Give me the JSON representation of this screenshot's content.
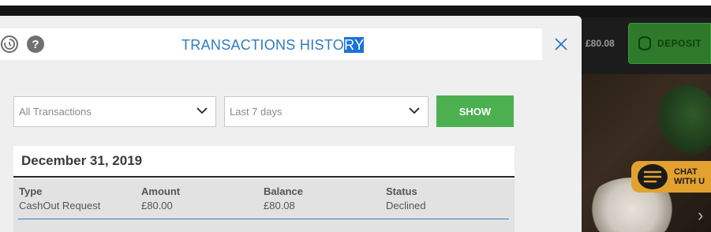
{
  "site": {
    "balance": "£80.08",
    "deposit_label": "DEPOSIT",
    "chat_line1": "CHAT",
    "chat_line2": "WITH U"
  },
  "modal": {
    "title_main": "TRANSACTIONS HISTO",
    "title_selected": "RY",
    "filters": {
      "type_value": "All Transactions",
      "period_value": "Last 7 days",
      "show_label": "SHOW"
    },
    "group_date": "December 31, 2019",
    "columns": [
      "Type",
      "Amount",
      "Balance",
      "Status"
    ],
    "transactions": [
      {
        "type": "CashOut Request",
        "amount": "£80.00",
        "balance": "£80.08",
        "status": "Declined"
      }
    ]
  },
  "icons": {
    "history": "history-icon",
    "help": "help-icon",
    "close": "close-icon",
    "chevron": "chevron-down-icon",
    "coins": "coins-icon",
    "chat": "chat-bubble-icon",
    "next": "chevron-right-icon"
  },
  "colors": {
    "accent_blue": "#2e7bbf",
    "show_green": "#4caf50",
    "deposit_green": "#2d7a2a",
    "chat_orange": "#e3a12f"
  }
}
